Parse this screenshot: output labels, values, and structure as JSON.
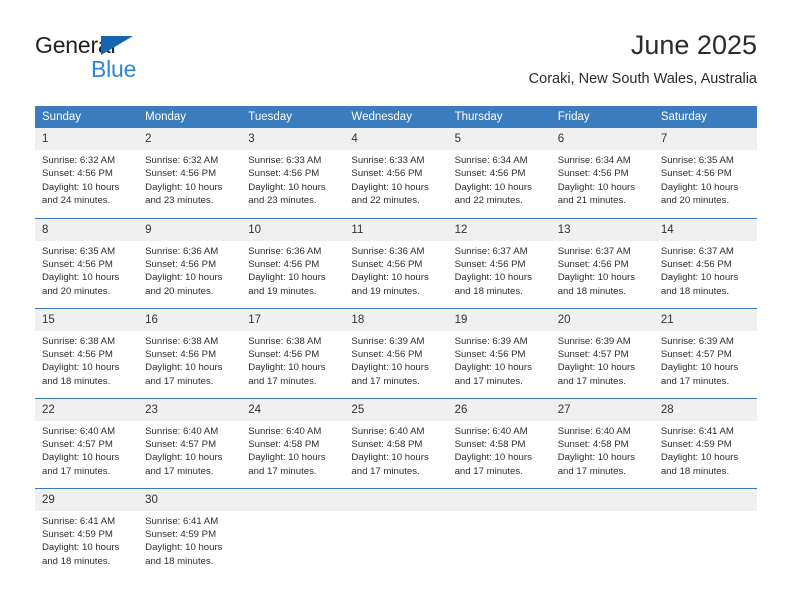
{
  "brand": {
    "name_dark": "General",
    "name_blue": "Blue",
    "triangle_icon": "triangle-icon",
    "accent_blue": "#2d87d6",
    "logo_blue": "#1565b0"
  },
  "header": {
    "title": "June 2025",
    "subtitle": "Coraki, New South Wales, Australia"
  },
  "calendar": {
    "header_bg": "#3a7cbe",
    "daynum_bg": "#f0f0f0",
    "weekdays": [
      "Sunday",
      "Monday",
      "Tuesday",
      "Wednesday",
      "Thursday",
      "Friday",
      "Saturday"
    ],
    "weeks": [
      [
        {
          "day": "1",
          "sunrise": "Sunrise: 6:32 AM",
          "sunset": "Sunset: 4:56 PM",
          "daylight": "Daylight: 10 hours and 24 minutes."
        },
        {
          "day": "2",
          "sunrise": "Sunrise: 6:32 AM",
          "sunset": "Sunset: 4:56 PM",
          "daylight": "Daylight: 10 hours and 23 minutes."
        },
        {
          "day": "3",
          "sunrise": "Sunrise: 6:33 AM",
          "sunset": "Sunset: 4:56 PM",
          "daylight": "Daylight: 10 hours and 23 minutes."
        },
        {
          "day": "4",
          "sunrise": "Sunrise: 6:33 AM",
          "sunset": "Sunset: 4:56 PM",
          "daylight": "Daylight: 10 hours and 22 minutes."
        },
        {
          "day": "5",
          "sunrise": "Sunrise: 6:34 AM",
          "sunset": "Sunset: 4:56 PM",
          "daylight": "Daylight: 10 hours and 22 minutes."
        },
        {
          "day": "6",
          "sunrise": "Sunrise: 6:34 AM",
          "sunset": "Sunset: 4:56 PM",
          "daylight": "Daylight: 10 hours and 21 minutes."
        },
        {
          "day": "7",
          "sunrise": "Sunrise: 6:35 AM",
          "sunset": "Sunset: 4:56 PM",
          "daylight": "Daylight: 10 hours and 20 minutes."
        }
      ],
      [
        {
          "day": "8",
          "sunrise": "Sunrise: 6:35 AM",
          "sunset": "Sunset: 4:56 PM",
          "daylight": "Daylight: 10 hours and 20 minutes."
        },
        {
          "day": "9",
          "sunrise": "Sunrise: 6:36 AM",
          "sunset": "Sunset: 4:56 PM",
          "daylight": "Daylight: 10 hours and 20 minutes."
        },
        {
          "day": "10",
          "sunrise": "Sunrise: 6:36 AM",
          "sunset": "Sunset: 4:56 PM",
          "daylight": "Daylight: 10 hours and 19 minutes."
        },
        {
          "day": "11",
          "sunrise": "Sunrise: 6:36 AM",
          "sunset": "Sunset: 4:56 PM",
          "daylight": "Daylight: 10 hours and 19 minutes."
        },
        {
          "day": "12",
          "sunrise": "Sunrise: 6:37 AM",
          "sunset": "Sunset: 4:56 PM",
          "daylight": "Daylight: 10 hours and 18 minutes."
        },
        {
          "day": "13",
          "sunrise": "Sunrise: 6:37 AM",
          "sunset": "Sunset: 4:56 PM",
          "daylight": "Daylight: 10 hours and 18 minutes."
        },
        {
          "day": "14",
          "sunrise": "Sunrise: 6:37 AM",
          "sunset": "Sunset: 4:56 PM",
          "daylight": "Daylight: 10 hours and 18 minutes."
        }
      ],
      [
        {
          "day": "15",
          "sunrise": "Sunrise: 6:38 AM",
          "sunset": "Sunset: 4:56 PM",
          "daylight": "Daylight: 10 hours and 18 minutes."
        },
        {
          "day": "16",
          "sunrise": "Sunrise: 6:38 AM",
          "sunset": "Sunset: 4:56 PM",
          "daylight": "Daylight: 10 hours and 17 minutes."
        },
        {
          "day": "17",
          "sunrise": "Sunrise: 6:38 AM",
          "sunset": "Sunset: 4:56 PM",
          "daylight": "Daylight: 10 hours and 17 minutes."
        },
        {
          "day": "18",
          "sunrise": "Sunrise: 6:39 AM",
          "sunset": "Sunset: 4:56 PM",
          "daylight": "Daylight: 10 hours and 17 minutes."
        },
        {
          "day": "19",
          "sunrise": "Sunrise: 6:39 AM",
          "sunset": "Sunset: 4:56 PM",
          "daylight": "Daylight: 10 hours and 17 minutes."
        },
        {
          "day": "20",
          "sunrise": "Sunrise: 6:39 AM",
          "sunset": "Sunset: 4:57 PM",
          "daylight": "Daylight: 10 hours and 17 minutes."
        },
        {
          "day": "21",
          "sunrise": "Sunrise: 6:39 AM",
          "sunset": "Sunset: 4:57 PM",
          "daylight": "Daylight: 10 hours and 17 minutes."
        }
      ],
      [
        {
          "day": "22",
          "sunrise": "Sunrise: 6:40 AM",
          "sunset": "Sunset: 4:57 PM",
          "daylight": "Daylight: 10 hours and 17 minutes."
        },
        {
          "day": "23",
          "sunrise": "Sunrise: 6:40 AM",
          "sunset": "Sunset: 4:57 PM",
          "daylight": "Daylight: 10 hours and 17 minutes."
        },
        {
          "day": "24",
          "sunrise": "Sunrise: 6:40 AM",
          "sunset": "Sunset: 4:58 PM",
          "daylight": "Daylight: 10 hours and 17 minutes."
        },
        {
          "day": "25",
          "sunrise": "Sunrise: 6:40 AM",
          "sunset": "Sunset: 4:58 PM",
          "daylight": "Daylight: 10 hours and 17 minutes."
        },
        {
          "day": "26",
          "sunrise": "Sunrise: 6:40 AM",
          "sunset": "Sunset: 4:58 PM",
          "daylight": "Daylight: 10 hours and 17 minutes."
        },
        {
          "day": "27",
          "sunrise": "Sunrise: 6:40 AM",
          "sunset": "Sunset: 4:58 PM",
          "daylight": "Daylight: 10 hours and 17 minutes."
        },
        {
          "day": "28",
          "sunrise": "Sunrise: 6:41 AM",
          "sunset": "Sunset: 4:59 PM",
          "daylight": "Daylight: 10 hours and 18 minutes."
        }
      ],
      [
        {
          "day": "29",
          "sunrise": "Sunrise: 6:41 AM",
          "sunset": "Sunset: 4:59 PM",
          "daylight": "Daylight: 10 hours and 18 minutes."
        },
        {
          "day": "30",
          "sunrise": "Sunrise: 6:41 AM",
          "sunset": "Sunset: 4:59 PM",
          "daylight": "Daylight: 10 hours and 18 minutes."
        },
        {
          "day": "",
          "sunrise": "",
          "sunset": "",
          "daylight": ""
        },
        {
          "day": "",
          "sunrise": "",
          "sunset": "",
          "daylight": ""
        },
        {
          "day": "",
          "sunrise": "",
          "sunset": "",
          "daylight": ""
        },
        {
          "day": "",
          "sunrise": "",
          "sunset": "",
          "daylight": ""
        },
        {
          "day": "",
          "sunrise": "",
          "sunset": "",
          "daylight": ""
        }
      ]
    ]
  }
}
